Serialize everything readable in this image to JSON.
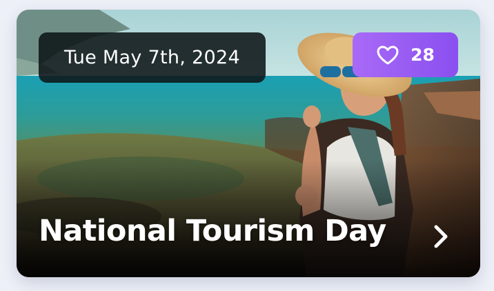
{
  "card": {
    "date": "Tue May 7th, 2024",
    "likes": "28",
    "title": "National Tourism Day",
    "icons": {
      "like": "heart-icon",
      "open": "chevron-right-icon"
    },
    "colors": {
      "like_chip": "#9b5cf4",
      "date_chip": "#0e1618",
      "text": "#ffffff"
    }
  }
}
